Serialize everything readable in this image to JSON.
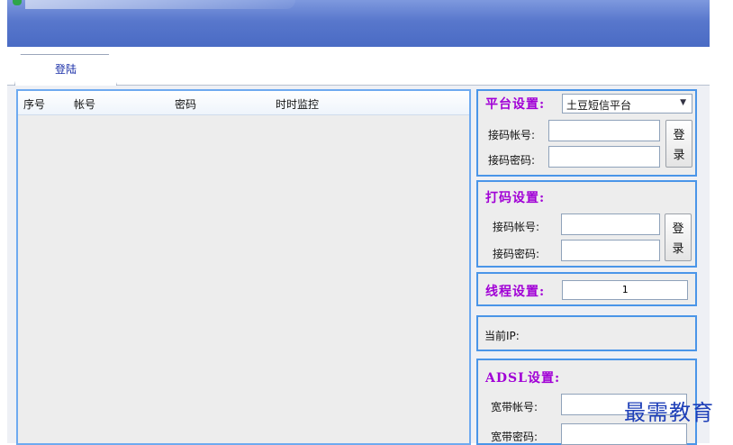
{
  "tabs": [
    {
      "label": "登陆"
    }
  ],
  "list": {
    "columns": [
      "序号",
      "帐号",
      "密码",
      "时时监控"
    ]
  },
  "platform_settings": {
    "title": "平台设置:",
    "platform_selected": "土豆短信平台",
    "account_label": "接码帐号:",
    "password_label": "接码密码:",
    "account_value": "",
    "password_value": "",
    "login_button": [
      "登",
      "录"
    ]
  },
  "captcha_settings": {
    "title": "打码设置:",
    "account_label": "接码帐号:",
    "password_label": "接码密码:",
    "account_value": "",
    "password_value": "",
    "login_button": [
      "登",
      "录"
    ]
  },
  "thread_settings": {
    "title": "线程设置:",
    "value": "1"
  },
  "current_ip": {
    "label": "当前IP:"
  },
  "adsl_settings": {
    "title": "ADSL设置:",
    "account_label": "宽带帐号:",
    "password_label": "宽带密码:",
    "account_value": "",
    "password_value": ""
  },
  "watermark": "最需教育",
  "colors": {
    "titlebar": "#5877cc",
    "group_border": "#4a95e8",
    "group_title": "#a100d6",
    "tab_text": "#1a2fa8",
    "watermark": "#1e3fb8"
  }
}
